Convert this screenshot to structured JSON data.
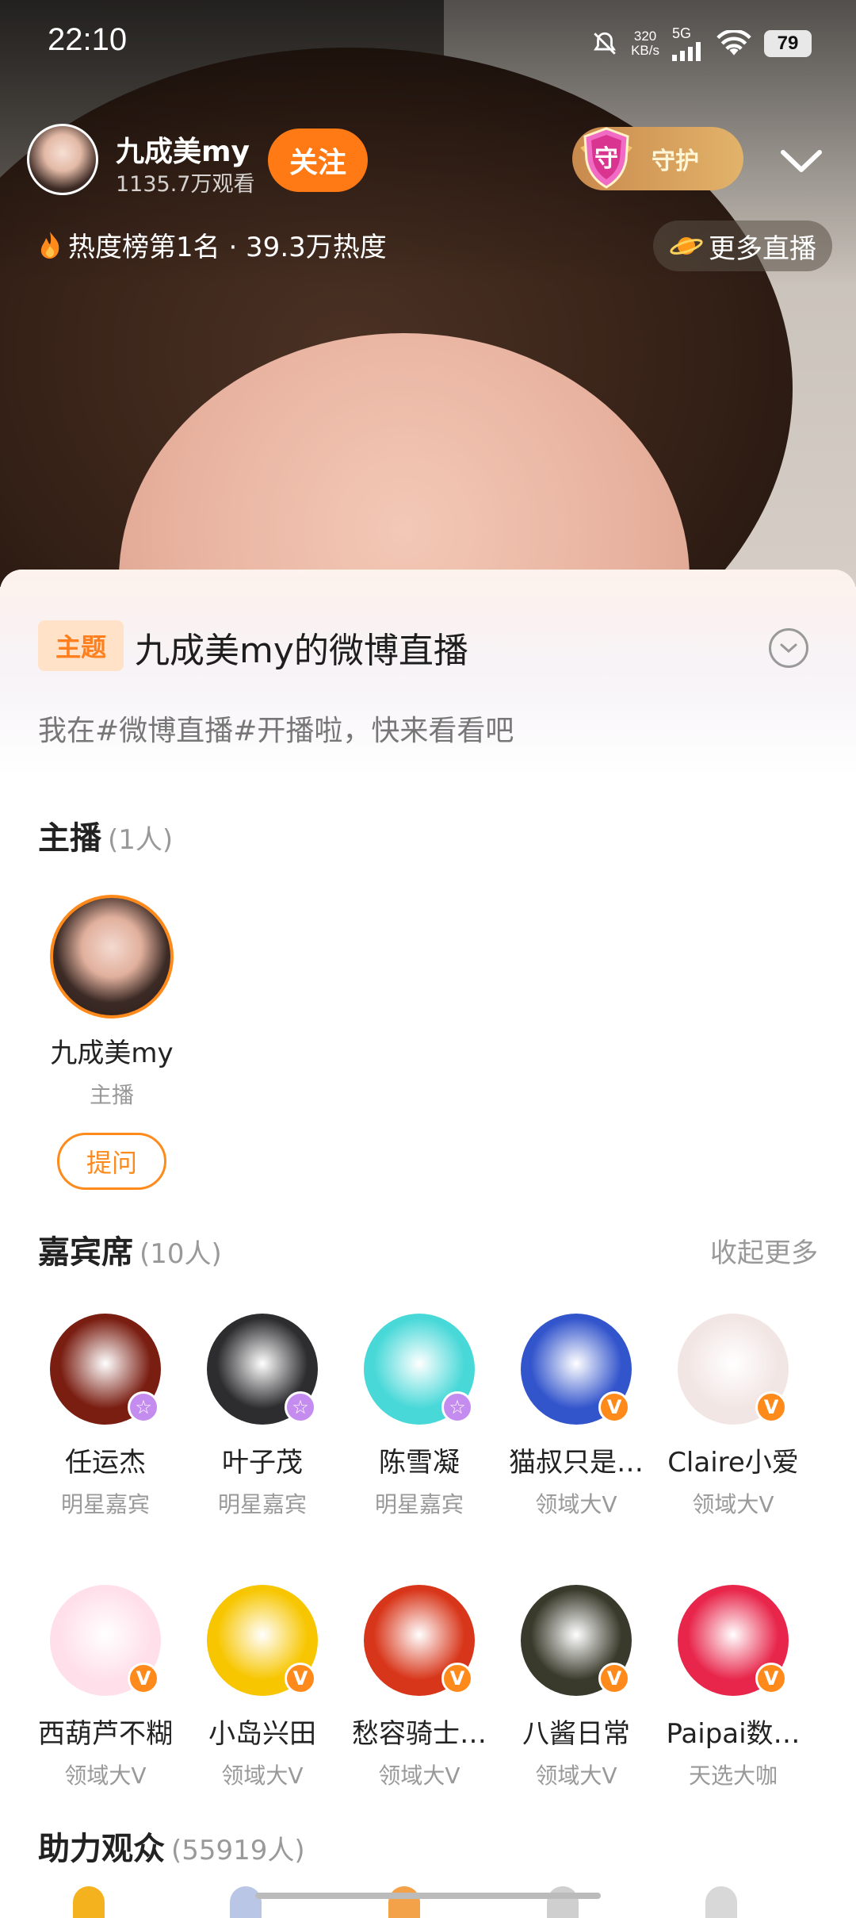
{
  "status_bar": {
    "time": "22:10",
    "speed_value": "320",
    "speed_unit": "KB/s",
    "network": "5G",
    "battery": "79"
  },
  "live_header": {
    "host_name": "九成美my",
    "viewers": "1135.7万观看",
    "follow_label": "关注",
    "guard_label": "守护",
    "guard_badge_char": "守",
    "heat_text": "热度榜第1名 · 39.3万热度",
    "more_live_label": "更多直播"
  },
  "topic": {
    "tag": "主题",
    "title": "九成美my的微博直播",
    "description": "我在#微博直播#开播啦，快来看看吧"
  },
  "anchor_section": {
    "title": "主播",
    "count": "(1人)",
    "anchor": {
      "name": "九成美my",
      "role": "主播"
    },
    "ask_label": "提问"
  },
  "guest_section": {
    "title": "嘉宾席",
    "count": "(10人)",
    "more_label": "收起更多",
    "guests": [
      {
        "name": "任运杰",
        "role": "明星嘉宾",
        "badge": "☆",
        "badge_type": "star",
        "avatar_color": "#7a1e12"
      },
      {
        "name": "叶子茂",
        "role": "明星嘉宾",
        "badge": "☆",
        "badge_type": "star",
        "avatar_color": "#2d2d30"
      },
      {
        "name": "陈雪凝",
        "role": "明星嘉宾",
        "badge": "☆",
        "badge_type": "star",
        "avatar_color": "#48d8d8"
      },
      {
        "name": "猫叔只是…",
        "role": "领域大V",
        "badge": "V",
        "badge_type": "v",
        "avatar_color": "#3355cc"
      },
      {
        "name": "Claire小爱",
        "role": "领域大V",
        "badge": "V",
        "badge_type": "v",
        "avatar_color": "#f2e6e4"
      },
      {
        "name": "西葫芦不糊",
        "role": "领域大V",
        "badge": "V",
        "badge_type": "v",
        "avatar_color": "#ffe0ea"
      },
      {
        "name": "小岛兴田",
        "role": "领域大V",
        "badge": "V",
        "badge_type": "v",
        "avatar_color": "#f7c600"
      },
      {
        "name": "愁容骑士…",
        "role": "领域大V",
        "badge": "V",
        "badge_type": "v",
        "avatar_color": "#d8361a"
      },
      {
        "name": "八酱日常",
        "role": "领域大V",
        "badge": "V",
        "badge_type": "v",
        "avatar_color": "#3a3a2c"
      },
      {
        "name": "Paipai数…",
        "role": "天选大咖",
        "badge": "V",
        "badge_type": "v",
        "avatar_color": "#e8254a"
      }
    ]
  },
  "audience_section": {
    "title": "助力观众",
    "count": "(55919人)"
  },
  "colors": {
    "accent": "#ff7a14",
    "star_badge": "#c58cf0",
    "v_badge": "#ff8a1c"
  }
}
